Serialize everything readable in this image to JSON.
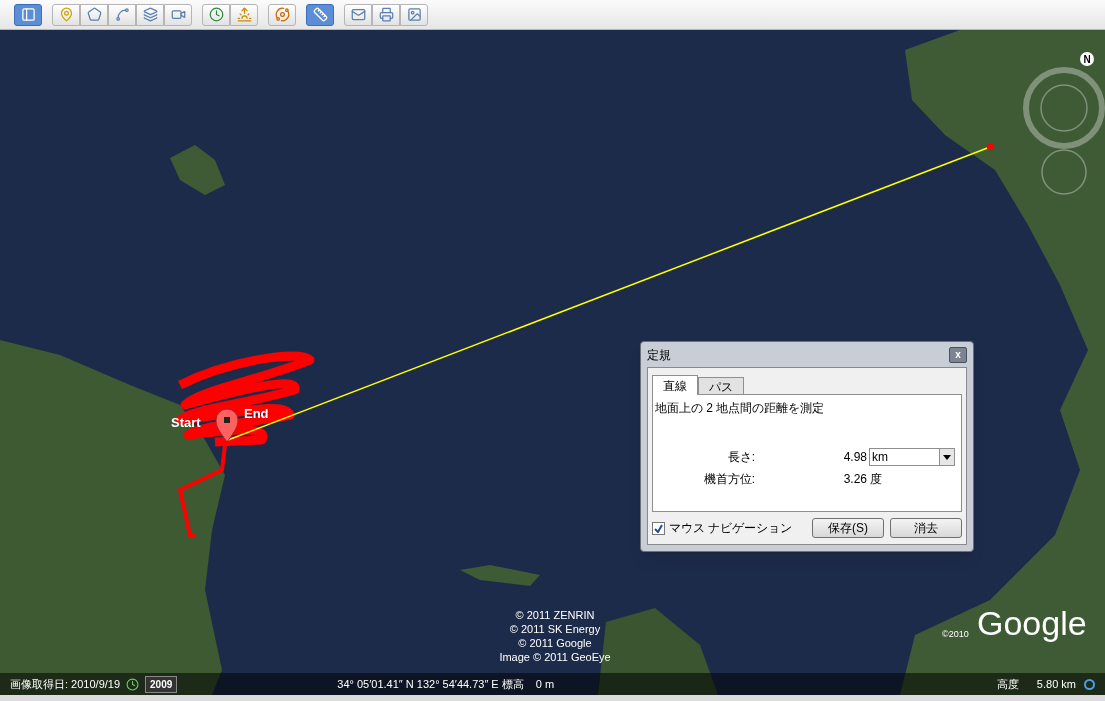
{
  "toolbar": {
    "groups": [
      [
        {
          "kind": "sidebar",
          "selected": true
        }
      ],
      [
        {
          "kind": "placemark",
          "selected": false
        },
        {
          "kind": "polygon",
          "selected": false
        },
        {
          "kind": "path",
          "selected": false
        },
        {
          "kind": "overlay",
          "selected": false
        },
        {
          "kind": "tour",
          "selected": false
        }
      ],
      [
        {
          "kind": "history",
          "selected": false
        },
        {
          "kind": "sun",
          "selected": false
        }
      ],
      [
        {
          "kind": "planet",
          "selected": false
        }
      ],
      [
        {
          "kind": "ruler",
          "selected": true
        }
      ],
      [
        {
          "kind": "email",
          "selected": false
        },
        {
          "kind": "print",
          "selected": false
        },
        {
          "kind": "image",
          "selected": false
        }
      ]
    ]
  },
  "map": {
    "compass": "N",
    "track_labels": {
      "start": "Start",
      "end": "End"
    },
    "attribution": [
      "© 2011 ZENRIN",
      "© 2011 SK Energy",
      "© 2011 Google",
      "Image © 2011 GeoEye"
    ],
    "logo_year": "©2010",
    "logo": "Google"
  },
  "ruler_dialog": {
    "title": "定規",
    "close": "x",
    "tabs": [
      {
        "label": "直線",
        "selected": true
      },
      {
        "label": "パス",
        "selected": false
      }
    ],
    "description": "地面上の 2 地点間の距離を測定",
    "rows": [
      {
        "kind": "select",
        "label": "長さ:",
        "value": "4.98",
        "unit": "km"
      },
      {
        "kind": "text",
        "label": "機首方位:",
        "value": "3.26",
        "unit": "度"
      }
    ],
    "mouse_navigation": {
      "label": "マウス ナビゲーション",
      "checked": true
    },
    "buttons": [
      "保存(S)",
      "消去"
    ]
  },
  "status_bar": {
    "imagery_date": "画像取得日: 2010/9/19",
    "historical_year": "2009",
    "coordinates": "34° 05′01.41″ N 132° 54′44.73″ E 標高",
    "elevation": "0 m",
    "altitude_label": "高度",
    "altitude": "5.80 km"
  }
}
